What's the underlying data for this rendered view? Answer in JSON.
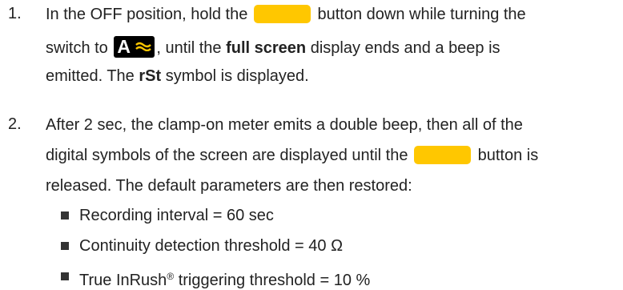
{
  "steps": [
    {
      "number": "1.",
      "line1": {
        "before": "In the OFF position, hold the",
        "after": "button down while turning the"
      },
      "line2": {
        "before": "switch to",
        "after": ", until the",
        "bold1": "full screen",
        "after2": "display ends and a beep is"
      },
      "line3": {
        "before": "emitted. The",
        "bold": "rSt",
        "after": "symbol is displayed."
      }
    },
    {
      "number": "2.",
      "line1": "After 2 sec, the clamp-on meter emits a double beep, then all of the",
      "line2": {
        "before": "digital symbols of the screen are displayed until the",
        "after": "button is"
      },
      "line3": "released. The default parameters are then restored:"
    }
  ],
  "mode_symbol": {
    "letter": "A",
    "icon": "ac-wave-icon",
    "bg": "#000000",
    "wave_color": "#FFC700"
  },
  "button_color": "#FFC700",
  "defaults": [
    "Recording interval = 60 sec",
    "Continuity detection threshold = 40 Ω",
    {
      "before": "True InRush",
      "sup": "®",
      "after": " triggering threshold = 10 %"
    }
  ]
}
